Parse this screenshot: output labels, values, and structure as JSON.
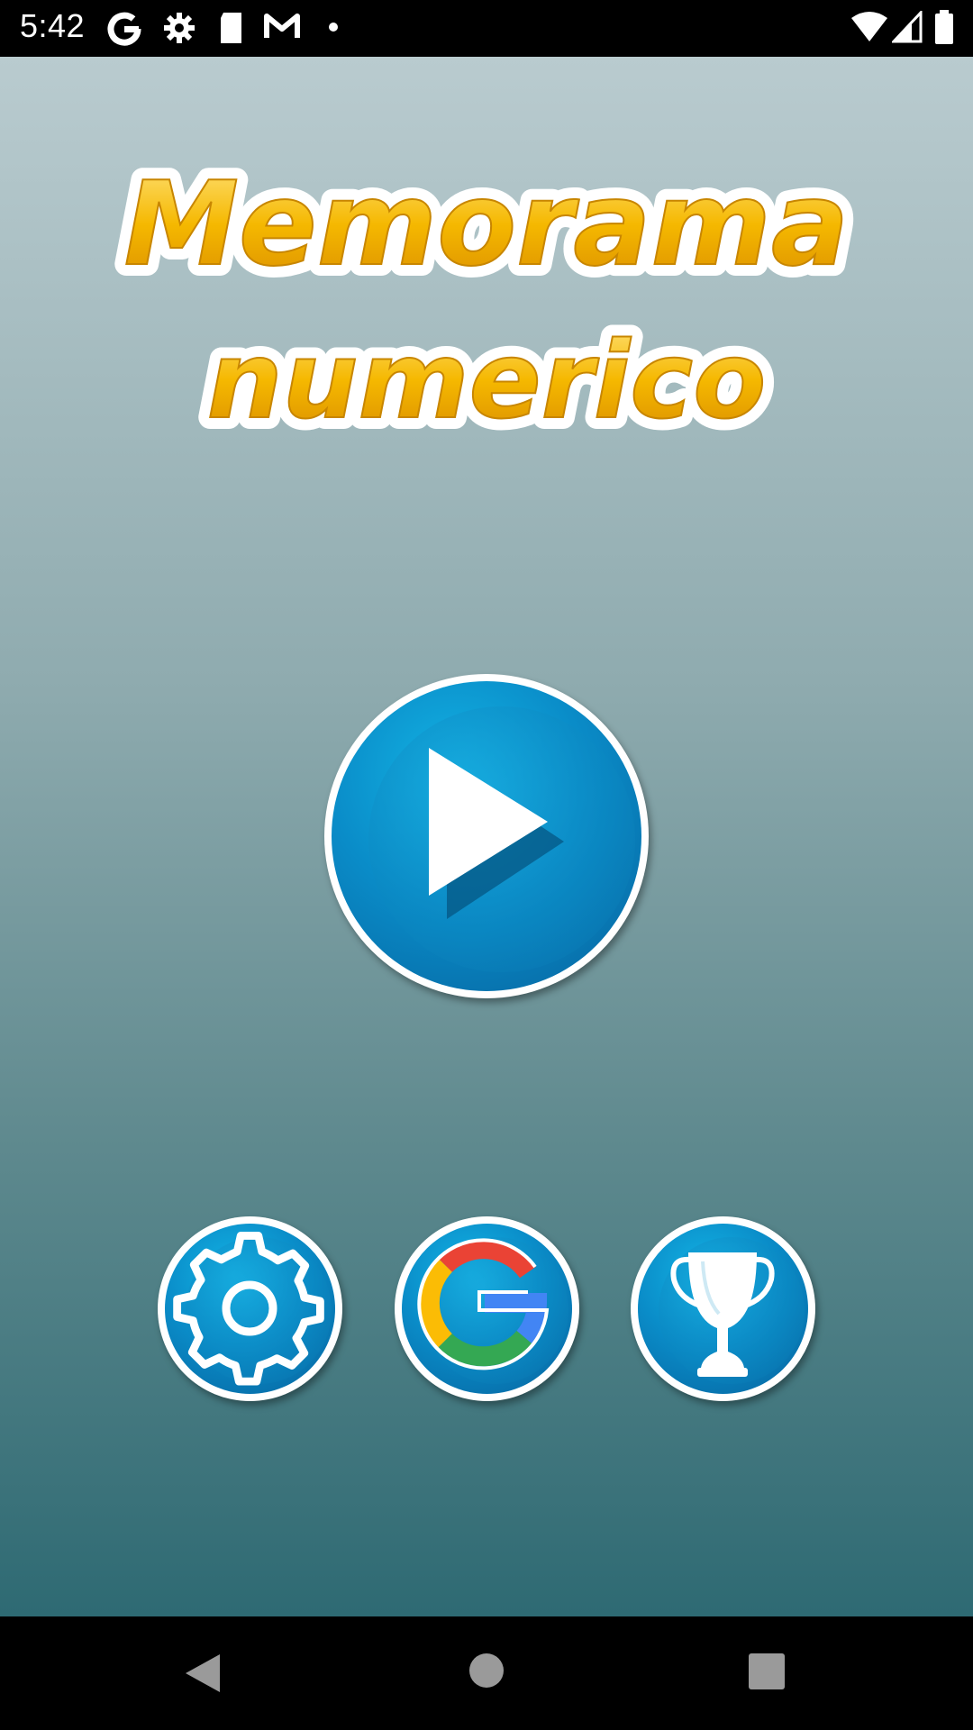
{
  "status_bar": {
    "time": "5:42",
    "left_icons": [
      "google-icon",
      "settings-icon",
      "sd-card-icon",
      "gmail-icon",
      "notification-dot-icon"
    ],
    "right_icons": [
      "wifi-icon",
      "signal-icon",
      "battery-icon"
    ]
  },
  "app": {
    "title_line1": "Memorama",
    "title_line2": "numerico",
    "title_color": "#f0b000"
  },
  "buttons": {
    "play": "play-icon",
    "settings": "gear-icon",
    "google_sign_in": "google-icon",
    "leaderboard": "trophy-icon"
  },
  "nav_bar": {
    "icons": [
      "back-icon",
      "home-icon",
      "recents-icon"
    ]
  }
}
